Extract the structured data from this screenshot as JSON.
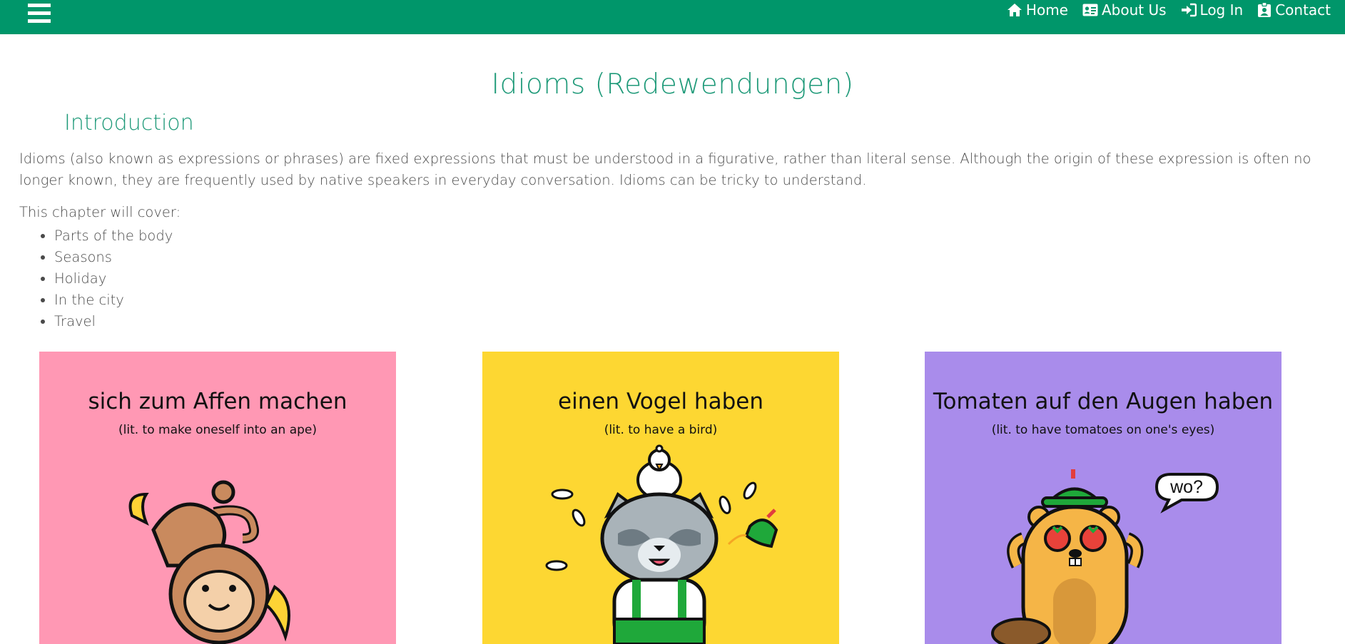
{
  "nav": {
    "links": [
      {
        "label": "Home",
        "icon": "home-icon"
      },
      {
        "label": "About Us",
        "icon": "id-card-icon"
      },
      {
        "label": "Log In",
        "icon": "sign-in-icon"
      },
      {
        "label": "Contact",
        "icon": "contact-badge-icon"
      }
    ]
  },
  "page": {
    "title": "Idioms (Redewendungen)",
    "section_heading": "Introduction",
    "intro": "Idioms (also known as expressions or phrases) are fixed expressions that must be understood in a figurative, rather than literal sense. Although the origin of these expression is often no longer known, they are frequently used by native speakers in everyday conversation. Idioms can be tricky to understand.",
    "cover_label": "This chapter will cover:",
    "topics": [
      "Parts of the body",
      "Seasons",
      "Holiday",
      "In the city",
      "Travel"
    ]
  },
  "cards": [
    {
      "title": "sich zum Affen machen",
      "subtitle": "(lit. to make oneself into an ape)",
      "color": "#ff98b4"
    },
    {
      "title": "einen Vogel haben",
      "subtitle": "(lit. to have a bird)",
      "color": "#fdd732"
    },
    {
      "title": "Tomaten auf den Augen haben",
      "subtitle": "(lit. to have tomatoes on one's eyes)",
      "color": "#a98ceb",
      "speech": "wo?"
    }
  ],
  "colors": {
    "brand": "#00966a",
    "heading": "#1f9a79"
  }
}
